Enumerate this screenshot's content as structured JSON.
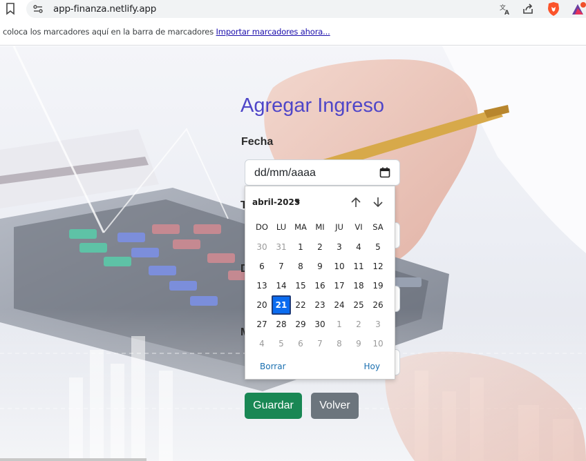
{
  "browser": {
    "url": "app-finanza.netlify.app",
    "bookmarks_text": "coloca los marcadores aquí en la barra de marcadores",
    "bookmarks_link": "Importar marcadores ahora..."
  },
  "form": {
    "title": "Agregar Ingreso",
    "fecha_label": "Fecha",
    "date_placeholder": "dd/mm/aaaa",
    "partial_labels": [
      "T",
      "D",
      "M"
    ],
    "save_label": "Guardar",
    "back_label": "Volver"
  },
  "datepicker": {
    "month_label": "abril-2025",
    "weekdays": [
      "DO",
      "LU",
      "MA",
      "MI",
      "JU",
      "VI",
      "SA"
    ],
    "weeks": [
      [
        "30",
        "31",
        "1",
        "2",
        "3",
        "4",
        "5"
      ],
      [
        "6",
        "7",
        "8",
        "9",
        "10",
        "11",
        "12"
      ],
      [
        "13",
        "14",
        "15",
        "16",
        "17",
        "18",
        "19"
      ],
      [
        "20",
        "21",
        "22",
        "23",
        "24",
        "25",
        "26"
      ],
      [
        "27",
        "28",
        "29",
        "30",
        "1",
        "2",
        "3"
      ],
      [
        "4",
        "5",
        "6",
        "7",
        "8",
        "9",
        "10"
      ]
    ],
    "selected_day": "21",
    "clear_label": "Borrar",
    "today_label": "Hoy"
  },
  "colors": {
    "title": "#4f46c8",
    "save_button": "#198754",
    "back_button": "#6c757d",
    "selected_day": "#0b6cf0",
    "link": "#1a6fb0"
  }
}
